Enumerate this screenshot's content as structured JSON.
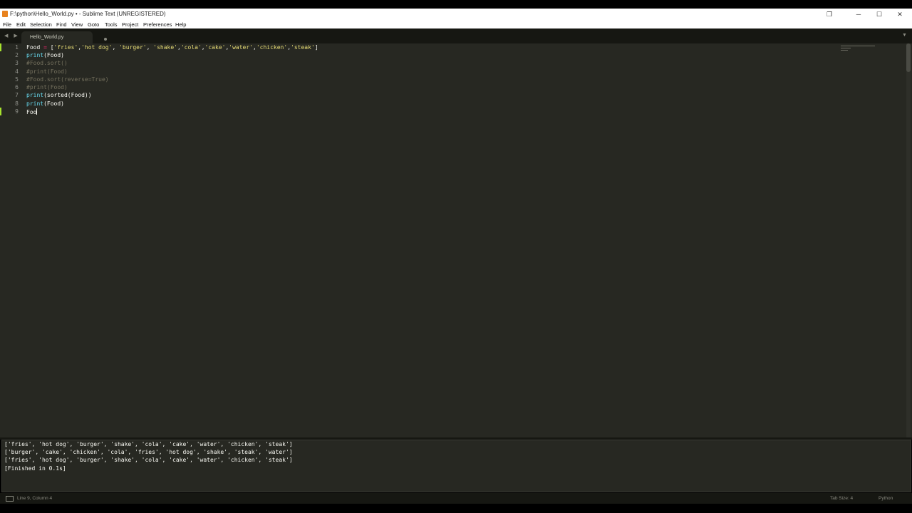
{
  "window": {
    "title": "F:\\python\\Hello_World.py • - Sublime Text (UNREGISTERED)",
    "icon": "sublime-text-icon",
    "controls": {
      "restore_icon": "❐",
      "minimize": "─",
      "maximize": "☐",
      "close": "✕"
    }
  },
  "menu": [
    "File",
    "Edit",
    "Selection",
    "Find",
    "View",
    "Goto",
    "Tools",
    "Project",
    "Preferences",
    "Help"
  ],
  "tabs": {
    "nav_arrows": "◀ ▶",
    "active_tab": "Hello_World.py",
    "dropdown": "▼"
  },
  "editor": {
    "line_numbers": [
      "1",
      "2",
      "3",
      "4",
      "5",
      "6",
      "7",
      "8",
      "9"
    ],
    "lines": {
      "l1": {
        "name": "Food",
        "op": " = ",
        "open": "[",
        "s1": "'fries'",
        "c1": ",",
        "s2": "'hot dog'",
        "c2": ", ",
        "s3": "'burger'",
        "c3": ", ",
        "s4": "'shake'",
        "c4": ",",
        "s5": "'cola'",
        "c5": ",",
        "s6": "'cake'",
        "c6": ",",
        "s7": "'water'",
        "c7": ",",
        "s8": "'chicken'",
        "c8": ",",
        "s9": "'steak'",
        "close": "]"
      },
      "l2": {
        "fn": "print",
        "rest": "(Food)"
      },
      "l3": "#Food.sort()",
      "l4": "#print(Food)",
      "l5": "#Food.sort(reverse=True)",
      "l6": "#print(Food)",
      "l7": {
        "fn": "print",
        "rest": "(sorted(Food))"
      },
      "l8": {
        "fn": "print",
        "rest": "(Food)"
      },
      "l9": "Foo"
    },
    "colors": {
      "background": "#272822",
      "keyword_operator": "#f92672",
      "string": "#e6db74",
      "function": "#66d9ef",
      "comment": "#75715e",
      "modified_marker": "#a6e22e"
    }
  },
  "output": [
    "['fries', 'hot dog', 'burger', 'shake', 'cola', 'cake', 'water', 'chicken', 'steak']",
    "['burger', 'cake', 'chicken', 'cola', 'fries', 'hot dog', 'shake', 'steak', 'water']",
    "['fries', 'hot dog', 'burger', 'shake', 'cola', 'cake', 'water', 'chicken', 'steak']",
    "[Finished in 0.1s]"
  ],
  "status": {
    "position": "Line 9, Column 4",
    "tab_size": "Tab Size: 4",
    "syntax": "Python"
  }
}
